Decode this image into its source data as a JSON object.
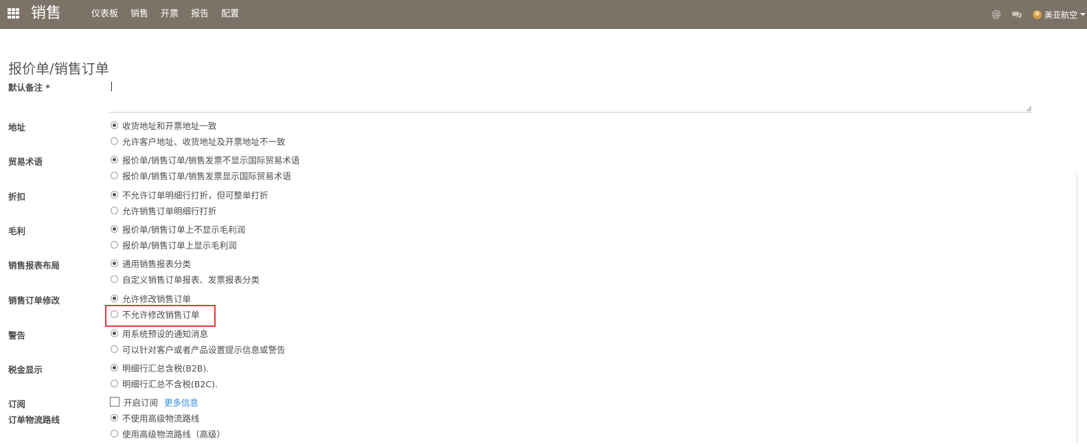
{
  "navbar": {
    "brand": "销售",
    "menu": [
      "仪表板",
      "销售",
      "开票",
      "报告",
      "配置"
    ],
    "at_symbol": "@",
    "user_name": "美亚航空"
  },
  "section_title": "报价单/销售订单",
  "default_note": {
    "label": "默认备注 *",
    "value": ""
  },
  "fields": [
    {
      "label": "地址",
      "options": [
        "收货地址和开票地址一致",
        "允许客户地址、收货地址及开票地址不一致"
      ],
      "selected": 0
    },
    {
      "label": "贸易术语",
      "options": [
        "报价单/销售订单/销售发票不显示国际贸易术语",
        "报价单/销售订单/销售发票显示国际贸易术语"
      ],
      "selected": 0
    },
    {
      "label": "折扣",
      "options": [
        "不允许订单明细行打折，但可整单打折",
        "允许销售订单明细行打折"
      ],
      "selected": 0
    },
    {
      "label": "毛利",
      "options": [
        "报价单/销售订单上不显示毛利润",
        "报价单/销售订单上显示毛利润"
      ],
      "selected": 0
    },
    {
      "label": "销售报表布局",
      "options": [
        "通用销售报表分类",
        "自定义销售订单报表、发票报表分类"
      ],
      "selected": 0
    },
    {
      "label": "销售订单修改",
      "options": [
        "允许修改销售订单",
        "不允许修改销售订单"
      ],
      "selected": 0
    },
    {
      "label": "警告",
      "options": [
        "用系统预设的通知消息",
        "可以针对客户或者产品设置提示信息或警告"
      ],
      "selected": 0
    },
    {
      "label": "税金显示",
      "options": [
        "明细行汇总含税(B2B).",
        "明细行汇总不含税(B2C)."
      ],
      "selected": 0
    }
  ],
  "subscription": {
    "label": "订阅",
    "checkbox_label": "开启订阅",
    "link": "更多信息",
    "checked": false
  },
  "logistics": {
    "label": "订单物流路线",
    "options": [
      "不使用高级物流路线",
      "使用高级物流路线（高级）"
    ],
    "selected": 0
  },
  "colors": {
    "navbar": "#7c7267",
    "highlight": "#e53935",
    "link": "#2f8ae0"
  }
}
